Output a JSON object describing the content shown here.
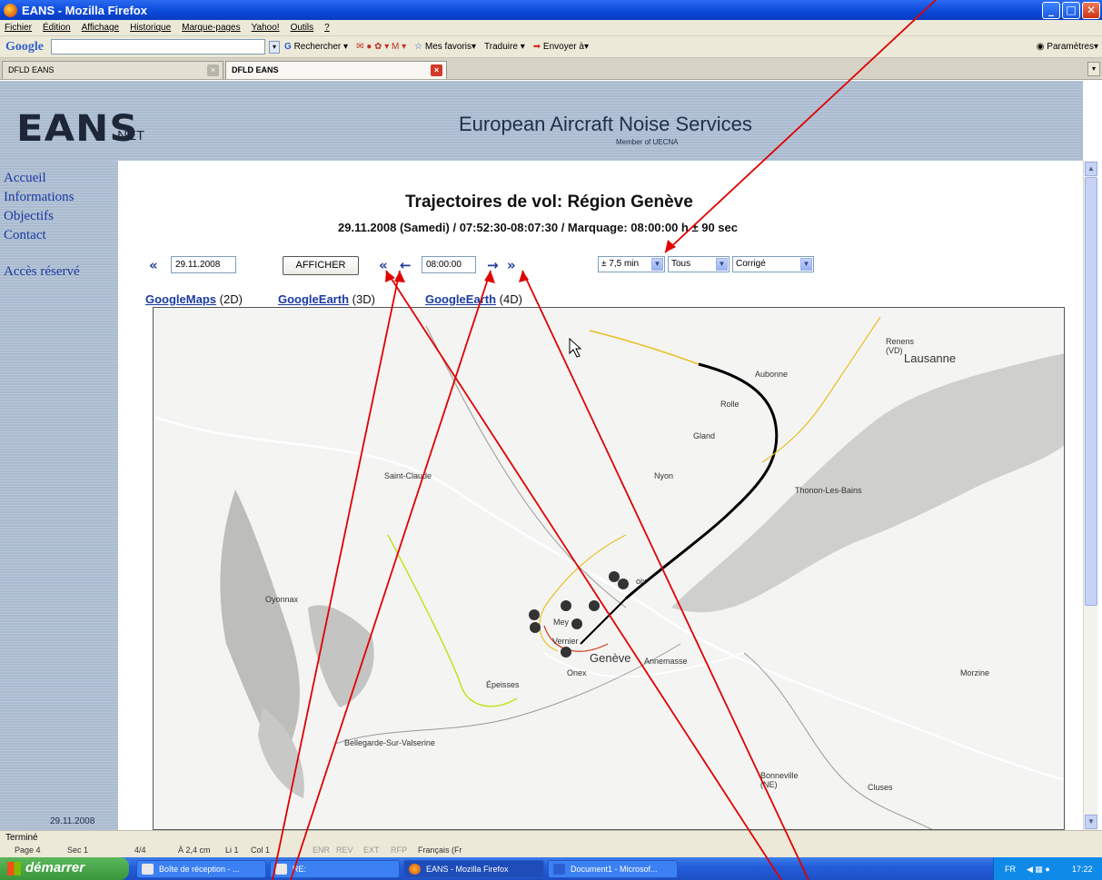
{
  "window": {
    "title": "EANS - Mozilla Firefox",
    "buttons": [
      "_",
      "□",
      "✕"
    ]
  },
  "menu": [
    "Fichier",
    "Édition",
    "Affichage",
    "Historique",
    "Marque-pages",
    "Yahoo!",
    "Outils",
    "?"
  ],
  "google_toolbar": {
    "logo": "Google",
    "search": "Rechercher",
    "favorites": "Mes favoris",
    "translate": "Traduire",
    "send": "Envoyer à",
    "settings": "Paramètres"
  },
  "tabs": [
    {
      "label": "DFLD EANS",
      "active": false
    },
    {
      "label": "DFLD EANS",
      "active": true
    }
  ],
  "header": {
    "logo": "EANS",
    "logo_suffix": ".NET",
    "title": "European Aircraft Noise Services",
    "subtitle": "Member of UECNA"
  },
  "sidebar": {
    "links": [
      "Accueil",
      "Informations",
      "Objectifs",
      "Contact",
      "Accès réservé"
    ],
    "date": "29.11.2008"
  },
  "page": {
    "title": "Trajectoires de vol: Région Genève",
    "subtitle": "29.11.2008 (Samedi) / 07:52:30-08:07:30 / Marquage: 08:00:00 h ± 90 sec"
  },
  "controls": {
    "date_prev": "«",
    "date_value": "29.11.2008",
    "afficher": "AFFICHER",
    "time_fast_back": "«",
    "time_back": "←",
    "time_value": "08:00:00",
    "time_fwd": "→",
    "time_fast_fwd": "»",
    "range_select": "± 7,5 min",
    "type_select": "Tous",
    "mode_select": "Corrigé"
  },
  "map_links": [
    {
      "label": "GoogleMaps",
      "suffix": "(2D)"
    },
    {
      "label": "GoogleEarth",
      "suffix": "(3D)"
    },
    {
      "label": "GoogleEarth",
      "suffix": "(4D)"
    }
  ],
  "map_places": {
    "renens": "Renens\n(VD)",
    "lausanne": "Lausanne",
    "aubonne": "Aubonne",
    "rolle": "Rolle",
    "gland": "Gland",
    "saint_claude": "Saint-Claude",
    "nyon": "Nyon",
    "thonon": "Thonon-Les-Bains",
    "oyonnax": "Oyonnax",
    "meyrin": "Mey",
    "vernier": "Vernier",
    "onex": "Onex",
    "geneve": "Genève",
    "annemasse": "Annemasse",
    "morzine": "Morzine",
    "epeisses": "Épeisses",
    "bellegarde": "Bellegarde-Sur-Valserine",
    "bonneville": "Bonneville\n(NE)",
    "cluses": "Cluses",
    "divonne": "oix"
  },
  "statusbar": {
    "text": "Terminé"
  },
  "word_statusbar": [
    "Page 4",
    "Sec 1",
    "4/4",
    "À 2,4 cm",
    "Li 1",
    "Col 1",
    "ENR",
    "REV",
    "EXT",
    "RFP",
    "Français (Fr"
  ],
  "taskbar": {
    "start": "démarrer",
    "tasks": [
      "Boîte de réception - ...",
      "RE:",
      "EANS - Mozilla Firefox",
      "Document1 - Microsof..."
    ],
    "lang": "FR",
    "clock": "17:22"
  },
  "colors": {
    "nav_blue": "#1a3aa0",
    "header_blue": "#aabbd0",
    "annotation_red": "#e00000",
    "track_black": "#000000",
    "track_yellow": "#e8c020"
  }
}
